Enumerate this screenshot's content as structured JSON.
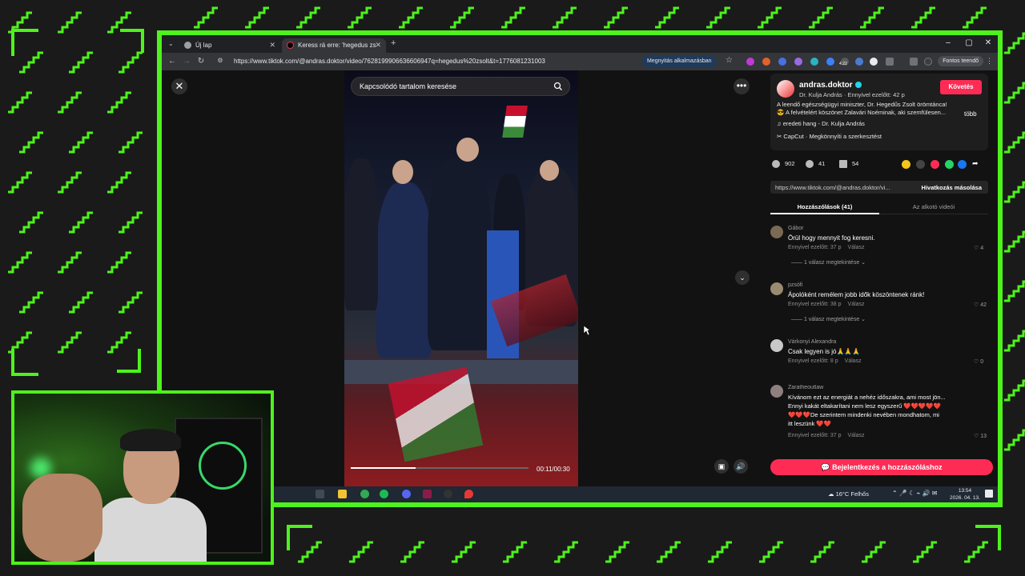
{
  "browser": {
    "tabs": [
      {
        "title": "Új lap"
      },
      {
        "title": "Keress rá erre: 'hegedus zs"
      }
    ],
    "url": "https://www.tiktok.com/@andras.doktor/video/7628199906636606947q=hegedus%20zsolt&t=1776081231003",
    "open_in_app": "Megnyitás alkalmazásban",
    "important_label": "Fontos teendő",
    "ext_badge": "4.22"
  },
  "video": {
    "search_placeholder": "Kapcsolódó tartalom keresése",
    "time": "00:11/00:30",
    "progress_fraction": 0.367
  },
  "author": {
    "username": "andras.doktor",
    "subline": "Dr. Kulja András · Ennyivel ezelőtt: 42 p",
    "follow": "Követés",
    "description_1": "A leendő egészségügyi miniszter, Dr. Hegedűs Zsolt örömtánca!",
    "description_2": "😎 A felvételért köszönet Zalavári Noéminak, aki szemfülesen...",
    "more": "több",
    "sound": "eredeti hang - Dr. Kulja András",
    "capcut": "CapCut · Megkönnyíti a szerkesztést"
  },
  "stats": {
    "likes": "902",
    "comments": "41",
    "saves": "54"
  },
  "share": {
    "link": "https://www.tiktok.com/@andras.doktor/vi...",
    "copy": "Hivatkozás másolása"
  },
  "panel_tabs": {
    "comments": "Hozzászólások (41)",
    "creator": "Az alkotó videói"
  },
  "comments": [
    {
      "user": "Gábor",
      "text": "Örül hogy mennyit fog keresni.",
      "time": "Ennyivel ezelőtt: 37 p",
      "reply": "Válasz",
      "likes": "4",
      "replies": "1 válasz megtekintése ⌄"
    },
    {
      "user": "pzsófi",
      "text": "Ápolóként remélem jobb idők köszöntenek ránk!",
      "time": "Ennyivel ezelőtt: 38 p",
      "reply": "Válasz",
      "likes": "42",
      "replies": "1 válasz megtekintése ⌄"
    },
    {
      "user": "Várkonyi Alexandra",
      "text": "Csak legyen is jó🙏🙏🙏",
      "time": "Ennyivel ezelőtt: 8 p",
      "reply": "Válasz",
      "likes": "0"
    },
    {
      "user": "Zaratheoutlaw",
      "text_1": "Kívánom ezt az energiát a nehéz időszakra, ami most jön...",
      "text_2": "Ennyi kakát eltakarítani nem lesz egyszerű ❤️❤️❤️❤️❤️",
      "text_3": "❤️❤️❤️De szerintem mindenki nevében mondhatom, mi",
      "text_4": "itt leszünk ❤️❤️",
      "time": "Ennyivel ezelőtt: 37 p",
      "reply": "Válasz",
      "likes": "13"
    }
  ],
  "login_button": "Bejelentkezés a hozzászóláshoz",
  "taskbar": {
    "weather": "16°C  Felhős",
    "time": "13:54",
    "date": "2026. 04. 13."
  },
  "colors": {
    "accent_green": "#4ef21c",
    "tiktok_red": "#fe2c55",
    "page_bg": "#121212"
  }
}
